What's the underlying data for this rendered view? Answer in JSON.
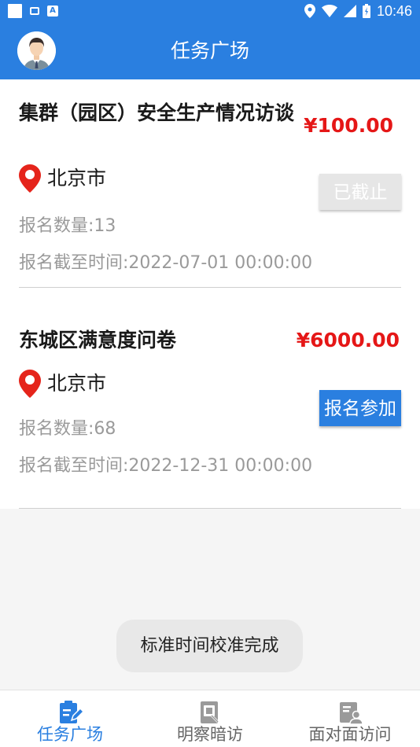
{
  "status_bar": {
    "time": "10:46"
  },
  "header": {
    "title": "任务广场"
  },
  "tasks": [
    {
      "title": "集群（园区）安全生产情况访谈",
      "price": "¥100.00",
      "location": "北京市",
      "signup_count": "报名数量:13",
      "deadline": "报名截至时间:2022-07-01 00:00:00",
      "button_label": "已截止",
      "button_state": "disabled"
    },
    {
      "title": "东城区满意度问卷",
      "price": "¥6000.00",
      "location": "北京市",
      "signup_count": "报名数量:68",
      "deadline": "报名截至时间:2022-12-31 00:00:00",
      "button_label": "报名参加",
      "button_state": "enabled"
    }
  ],
  "toast": {
    "message": "标准时间校准完成"
  },
  "tab_bar": {
    "tabs": [
      {
        "label": "任务广场",
        "icon": "task-edit-icon",
        "active": true
      },
      {
        "label": "明察暗访",
        "icon": "inspection-icon",
        "active": false
      },
      {
        "label": "面对面访问",
        "icon": "interview-icon",
        "active": false
      }
    ]
  },
  "colors": {
    "primary": "#2a7fe0",
    "price": "#e51717",
    "disabled_button": "#e6e6e6",
    "location_pin": "#e5241b"
  }
}
